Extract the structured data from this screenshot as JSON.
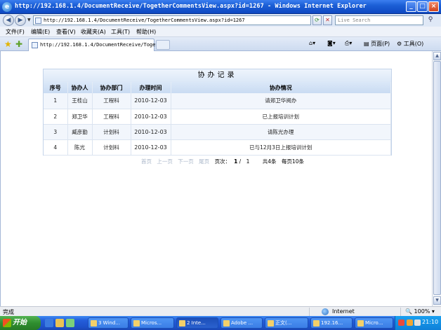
{
  "window": {
    "title": "http://192.168.1.4/DocumentReceive/TogetherCommentsView.aspx?id=1267 - Windows Internet Explorer",
    "minimize": "_",
    "maximize": "□",
    "close": "×"
  },
  "address": {
    "url": "http://192.168.1.4/DocumentReceive/TogetherCommentsView.aspx?id=1267",
    "search_placeholder": "Live Search"
  },
  "menu": {
    "items": [
      "文件(F)",
      "编辑(E)",
      "查看(V)",
      "收藏夹(A)",
      "工具(T)",
      "帮助(H)"
    ]
  },
  "tabs": {
    "active_title": "http://192.168.1.4/DocumentReceive/Togeth...",
    "tools": {
      "page": "页面(P)",
      "tools": "工具(O)"
    }
  },
  "records": {
    "title": "协办记录",
    "columns": [
      "序号",
      "协办人",
      "协办部门",
      "办理时间",
      "协办情况"
    ],
    "rows": [
      {
        "no": "1",
        "person": "王桂山",
        "dept": "工程科",
        "date": "2010-12-03",
        "status": "请郑卫华阅办"
      },
      {
        "no": "2",
        "person": "郑卫华",
        "dept": "工程科",
        "date": "2010-12-03",
        "status": "已上报培训计划"
      },
      {
        "no": "3",
        "person": "臧彦勤",
        "dept": "计划科",
        "date": "2010-12-03",
        "status": "请陈光办理"
      },
      {
        "no": "4",
        "person": "陈光",
        "dept": "计划科",
        "date": "2010-12-03",
        "status": "已与12月3日上报培训计划"
      }
    ]
  },
  "pager": {
    "first": "首页",
    "prev": "上一页",
    "next": "下一页",
    "last": "尾页",
    "page_label": "页次：",
    "page_current": "1",
    "page_sep": "/",
    "page_total": "1",
    "total": "共4条",
    "per_page": "每页10条"
  },
  "status": {
    "text": "完成",
    "zone": "Internet",
    "zoom": "100%"
  },
  "taskbar": {
    "start": "开始",
    "tasks": [
      "3 Wind...",
      "Micros...",
      "2 Inte...",
      "Adobe ...",
      "正文(...",
      "192.16...",
      "Micro..."
    ],
    "clock": "21:10"
  }
}
